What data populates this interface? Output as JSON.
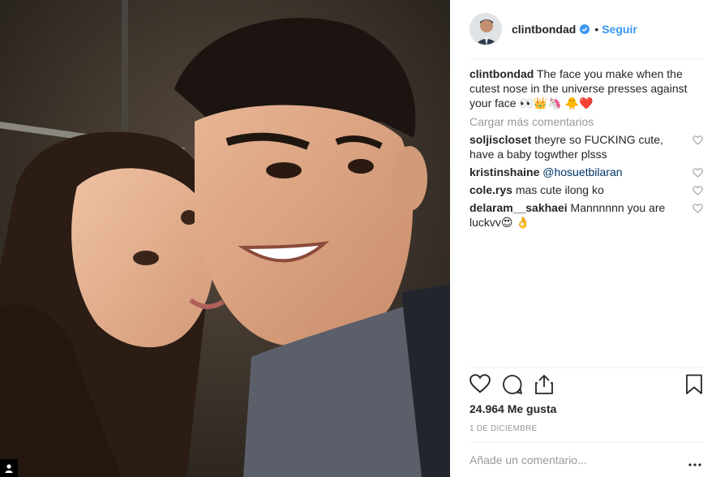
{
  "post": {
    "username": "clintbondad",
    "follow_label": "Seguir",
    "separator": "•",
    "caption_user": "clintbondad",
    "caption_text": "The face you make when the cutest nose in the universe presses against your face 👀👑🦄 🐥❤️",
    "load_more": "Cargar más comentarios",
    "likes": "24.964 Me gusta",
    "date": "1 DE DICIEMBRE",
    "add_comment_placeholder": "Añade un comentario...",
    "more_options": "..."
  },
  "comments": [
    {
      "user": "soljiscloset",
      "text": "theyre so FUCKING cute, have a baby togwther plsss"
    },
    {
      "user": "kristinshaine",
      "text": "@hosuetbilaran"
    },
    {
      "user": "cole.rys",
      "text": "mas cute ilong ko"
    },
    {
      "user": "delaram__sakhaei",
      "text": "Mannnnnn you are luckvv😍 👌"
    }
  ],
  "icons": {
    "verified": "verified-badge-icon",
    "like": "heart-icon",
    "comment": "comment-bubble-icon",
    "share": "share-icon",
    "save": "bookmark-icon",
    "tag": "user-tag-icon"
  },
  "colors": {
    "link": "#3897f0",
    "muted": "#999999",
    "text": "#262626"
  }
}
